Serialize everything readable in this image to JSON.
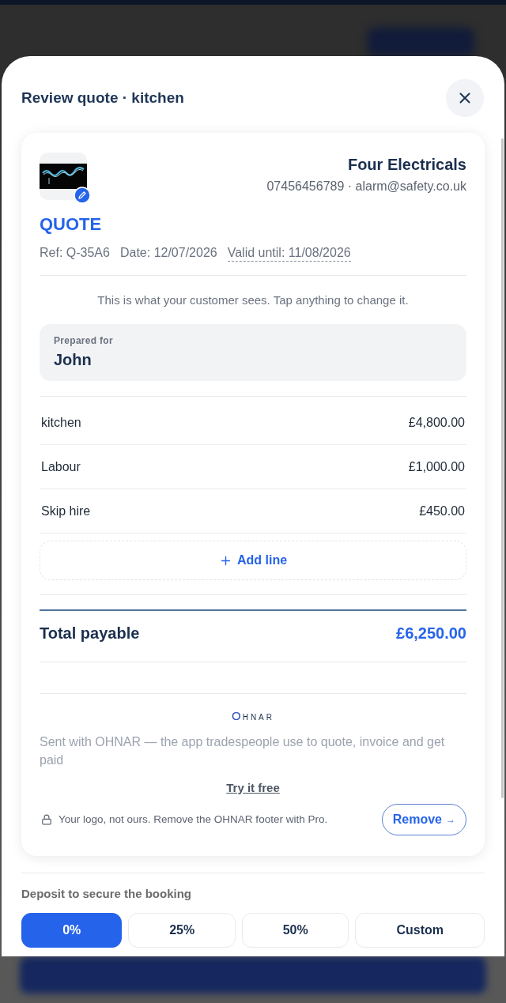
{
  "header": {
    "title": "Review quote · kitchen"
  },
  "quote": {
    "business": {
      "name": "Four Electricals",
      "contact": "07456456789 · alarm@safety.co.uk"
    },
    "doc_title": "QUOTE",
    "meta": [
      {
        "kind": "plain",
        "text": "Ref: Q-35A6"
      },
      {
        "kind": "plain",
        "text": "Date: 12/07/2026"
      },
      {
        "kind": "editable",
        "text": "Valid until: 11/08/2026"
      }
    ],
    "notice": "This is what your customer sees. Tap anything to change it.",
    "prepared_for": {
      "label": "Prepared for",
      "name": "John"
    },
    "lines": [
      {
        "description": "kitchen",
        "amount": "£4,800.00"
      },
      {
        "description": "Labour",
        "amount": "£1,000.00"
      },
      {
        "description": "Skip hire",
        "amount": "£450.00"
      }
    ],
    "add_line": "Add line",
    "total": {
      "label": "Total payable",
      "amount": "£6,250.00"
    },
    "footer": {
      "logo": "OHNAR",
      "tagline": "Sent with OHNAR — the app tradespeople use to quote, invoice and get paid",
      "cta": "Try it free",
      "pro_note": "Your logo, not ours. Remove the OHNAR footer with Pro.",
      "remove": {
        "label": "Remove",
        "arrow": "→"
      }
    }
  },
  "deposit": {
    "label": "Deposit to secure the booking",
    "options": [
      {
        "label": "0%",
        "selected": true
      },
      {
        "label": "25%",
        "selected": false
      },
      {
        "label": "50%",
        "selected": false
      },
      {
        "label": "Custom",
        "selected": false
      }
    ]
  }
}
